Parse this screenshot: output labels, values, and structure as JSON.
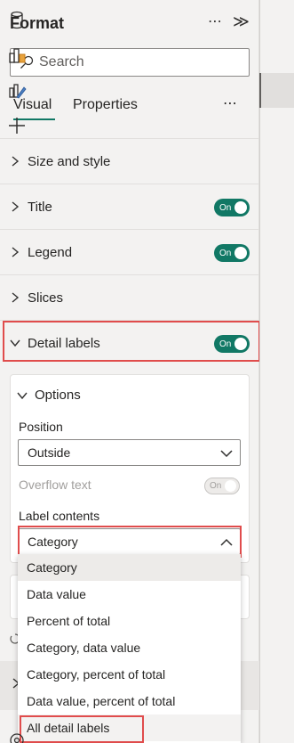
{
  "header": {
    "title": "Format",
    "more": "⋯",
    "collapse": "≫"
  },
  "search": {
    "placeholder": "Search"
  },
  "tabs": [
    {
      "label": "Visual"
    },
    {
      "label": "Properties"
    }
  ],
  "tabs_more": "⋯",
  "sections": [
    {
      "label": "Size and style"
    },
    {
      "label": "Title",
      "toggle": "On"
    },
    {
      "label": "Legend",
      "toggle": "On"
    },
    {
      "label": "Slices"
    },
    {
      "label": "Detail labels",
      "toggle": "On"
    }
  ],
  "options": {
    "title": "Options",
    "position_label": "Position",
    "position_value": "Outside",
    "overflow_label": "Overflow text",
    "overflow_toggle": "On",
    "label_contents_label": "Label contents",
    "label_contents_value": "Category"
  },
  "dropdown_menu": [
    "Category",
    "Data value",
    "Percent of total",
    "Category, data value",
    "Category, percent of total",
    "Data value, percent of total",
    "All detail labels"
  ],
  "colors": {
    "accent": "#117865",
    "highlight": "#e04c4c"
  }
}
